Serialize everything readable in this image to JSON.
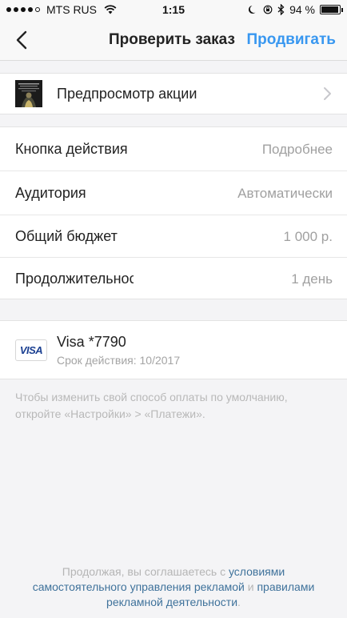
{
  "status_bar": {
    "carrier": "MTS RUS",
    "time": "1:15",
    "battery_percent": "94 %",
    "battery_level": 0.94
  },
  "nav": {
    "title": "Проверить заказ",
    "action": "Продвигать"
  },
  "preview": {
    "label": "Предпросмотр акции"
  },
  "settings": {
    "rows": [
      {
        "label": "Кнопка действия",
        "value": "Подробнее"
      },
      {
        "label": "Аудитория",
        "value": "Автоматически"
      },
      {
        "label": "Общий бюджет",
        "value": "1 000 р."
      },
      {
        "label": "Продолжительность",
        "value": "1 день"
      }
    ]
  },
  "payment": {
    "card_logo": "VISA",
    "card_name": "Visa *7790",
    "expiry": "Срок действия: 10/2017"
  },
  "info": {
    "text": "Чтобы изменить свой способ оплаты по умолчанию, откройте «Настройки» > «Платежи»."
  },
  "footer": {
    "prefix": "Продолжая, вы соглашаетесь с ",
    "link1": "условиями самостоятельного управления рекламой",
    "middle": " и ",
    "link2": "правилами рекламной деятельности",
    "suffix": "."
  },
  "colors": {
    "accent": "#3897f0",
    "link": "#3f729b"
  }
}
